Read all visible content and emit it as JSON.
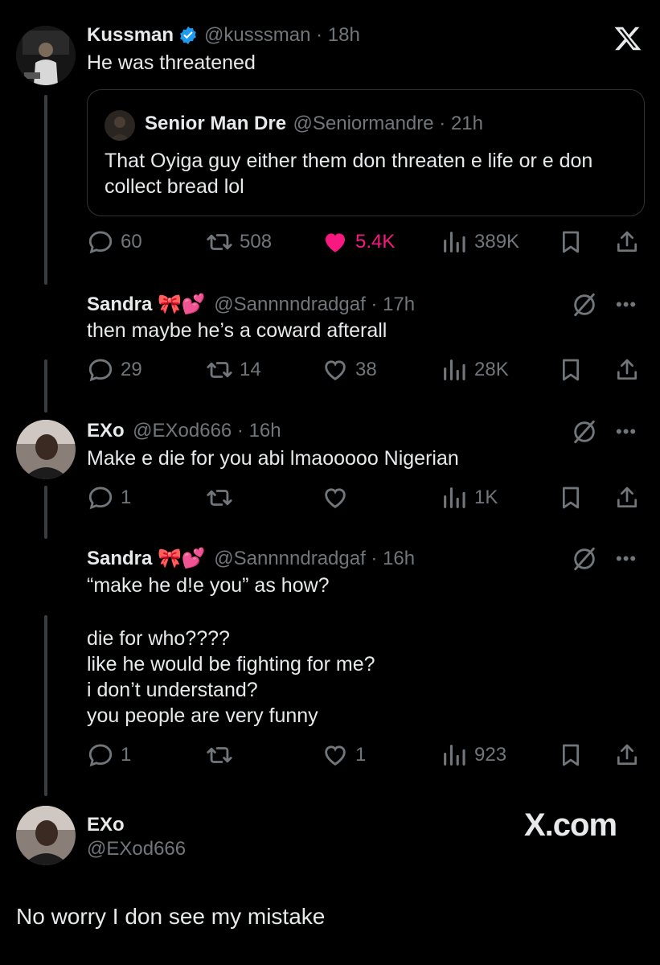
{
  "colors": {
    "background": "#000000",
    "text": "#e7e9ea",
    "muted": "#71767b",
    "like": "#f91880",
    "verified": "#1d9bf0"
  },
  "main_tweet": {
    "name": "Kussman",
    "verified_icon": "verified-badge-icon",
    "handle_time": "@kusssman · 18h",
    "text": "He was threatened",
    "quote": {
      "name": "Senior Man Dre",
      "handle_time": "@Seniormandre · 21h",
      "text": "That Oyiga guy either them don threaten e life or e don collect bread lol"
    },
    "replies": "60",
    "reposts": "508",
    "likes": "5.4K",
    "views": "389K"
  },
  "reply1": {
    "name": "Sandra 🎀💕",
    "handle_time": "@Sannnndradgaf · 17h",
    "text": "then maybe he’s a coward afterall",
    "replies": "29",
    "reposts": "14",
    "likes": "38",
    "views": "28K"
  },
  "reply2": {
    "name": "EXo",
    "handle_time": "@EXod666 · 16h",
    "text": "Make e die for you abi lmaooooo Nigerian",
    "replies": "1",
    "reposts": "",
    "likes": "",
    "views": "1K"
  },
  "reply3": {
    "name": "Sandra 🎀💕",
    "handle_time": "@Sannnndradgaf · 16h",
    "text_line1": "“make he d!e you” as how?",
    "text_rest": "die for who????\nlike he would be fighting for me?\ni don’t understand?\nyou people are very funny",
    "replies": "1",
    "reposts": "",
    "likes": "1",
    "views": "923"
  },
  "footer": {
    "name": "EXo",
    "handle": "@EXod666",
    "brand": "X.com",
    "text": "No worry I don see my mistake"
  },
  "more_label": "•••"
}
